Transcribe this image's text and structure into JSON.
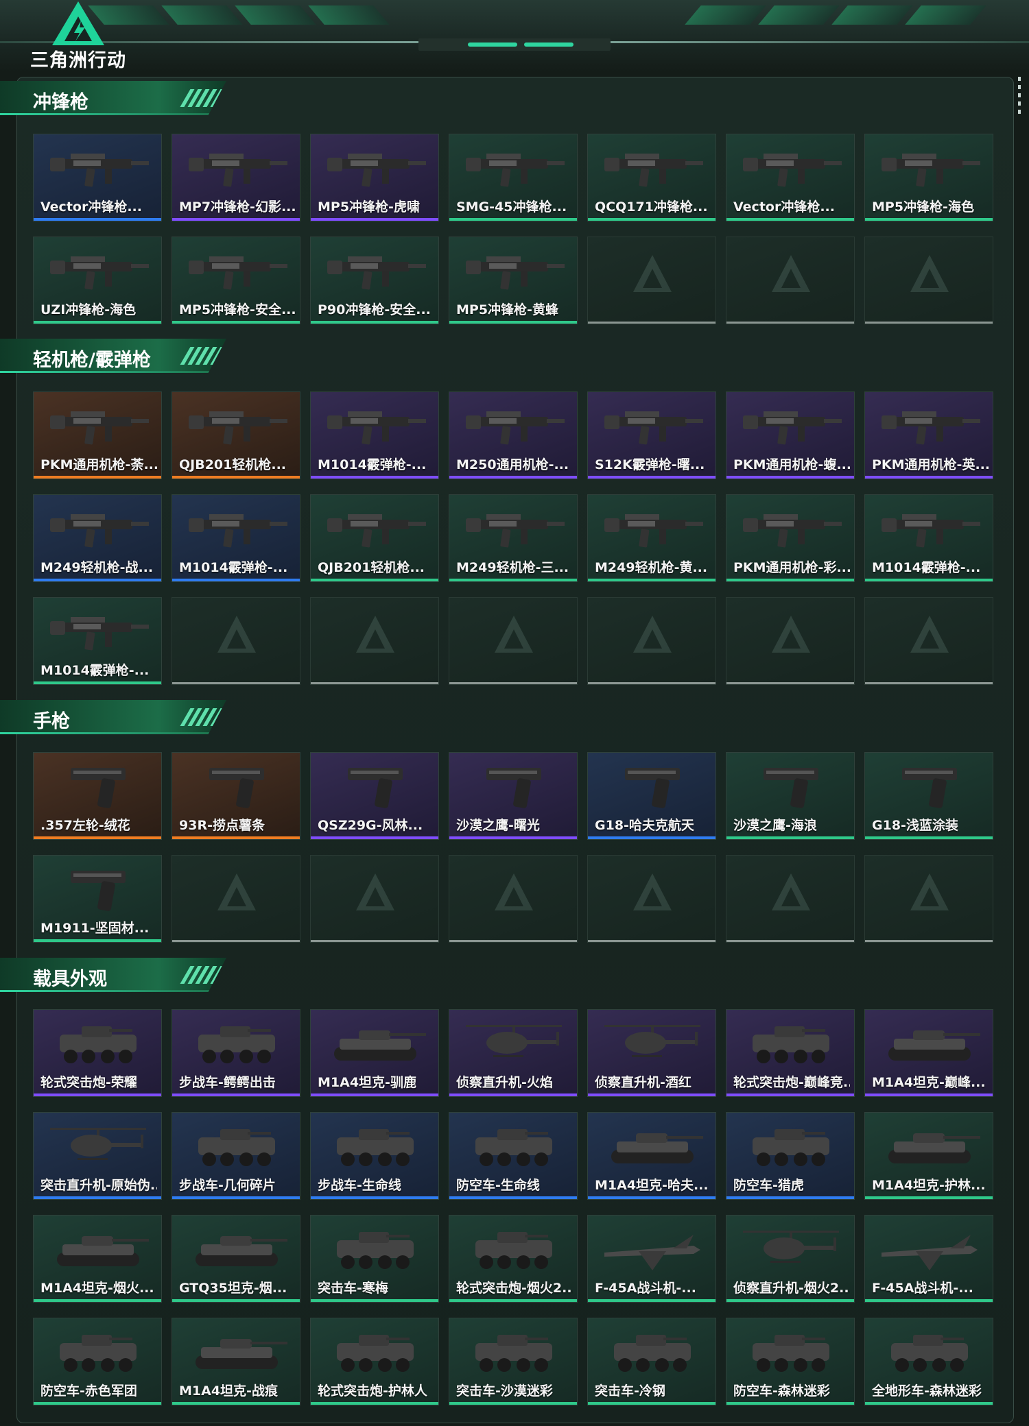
{
  "brand": {
    "logo_text": "三角洲行动"
  },
  "sections": [
    {
      "title": "冲锋枪",
      "items": [
        {
          "name": "Vector冲锋枪...",
          "rarity": "blue",
          "icon": "gun-icon"
        },
        {
          "name": "MP7冲锋枪-幻影...",
          "rarity": "purple",
          "icon": "gun-icon"
        },
        {
          "name": "MP5冲锋枪-虎啸",
          "rarity": "purple",
          "icon": "gun-icon"
        },
        {
          "name": "SMG-45冲锋枪...",
          "rarity": "green",
          "icon": "gun-icon"
        },
        {
          "name": "QCQ171冲锋枪...",
          "rarity": "green",
          "icon": "gun-icon"
        },
        {
          "name": "Vector冲锋枪...",
          "rarity": "green",
          "icon": "gun-icon"
        },
        {
          "name": "MP5冲锋枪-海色",
          "rarity": "green",
          "icon": "gun-icon"
        },
        {
          "name": "UZI冲锋枪-海色",
          "rarity": "green",
          "icon": "gun-icon"
        },
        {
          "name": "MP5冲锋枪-安全...",
          "rarity": "green",
          "icon": "gun-icon"
        },
        {
          "name": "P90冲锋枪-安全...",
          "rarity": "green",
          "icon": "gun-icon"
        },
        {
          "name": "MP5冲锋枪-黄蜂",
          "rarity": "green",
          "icon": "gun-icon"
        },
        {
          "name": "",
          "rarity": "empty"
        },
        {
          "name": "",
          "rarity": "empty"
        },
        {
          "name": "",
          "rarity": "empty"
        }
      ]
    },
    {
      "title": "轻机枪/霰弹枪",
      "items": [
        {
          "name": "PKM通用机枪-荼...",
          "rarity": "orange",
          "icon": "gun-icon"
        },
        {
          "name": "QJB201轻机枪...",
          "rarity": "orange",
          "icon": "gun-icon"
        },
        {
          "name": "M1014霰弹枪-...",
          "rarity": "purple",
          "icon": "gun-icon"
        },
        {
          "name": "M250通用机枪-...",
          "rarity": "purple",
          "icon": "gun-icon"
        },
        {
          "name": "S12K霰弹枪-曙...",
          "rarity": "purple",
          "icon": "gun-icon"
        },
        {
          "name": "PKM通用机枪-蝮...",
          "rarity": "purple",
          "icon": "gun-icon"
        },
        {
          "name": "PKM通用机枪-英...",
          "rarity": "purple",
          "icon": "gun-icon"
        },
        {
          "name": "M249轻机枪-战...",
          "rarity": "blue",
          "icon": "gun-icon"
        },
        {
          "name": "M1014霰弹枪-...",
          "rarity": "blue",
          "icon": "gun-icon"
        },
        {
          "name": "QJB201轻机枪...",
          "rarity": "green",
          "icon": "gun-icon"
        },
        {
          "name": "M249轻机枪-三...",
          "rarity": "green",
          "icon": "gun-icon"
        },
        {
          "name": "M249轻机枪-黄...",
          "rarity": "green",
          "icon": "gun-icon"
        },
        {
          "name": "PKM通用机枪-彩...",
          "rarity": "green",
          "icon": "gun-icon"
        },
        {
          "name": "M1014霰弹枪-...",
          "rarity": "green",
          "icon": "gun-icon"
        },
        {
          "name": "M1014霰弹枪-...",
          "rarity": "green",
          "icon": "gun-icon"
        },
        {
          "name": "",
          "rarity": "empty"
        },
        {
          "name": "",
          "rarity": "empty"
        },
        {
          "name": "",
          "rarity": "empty"
        },
        {
          "name": "",
          "rarity": "empty"
        },
        {
          "name": "",
          "rarity": "empty"
        },
        {
          "name": "",
          "rarity": "empty"
        }
      ]
    },
    {
      "title": "手枪",
      "items": [
        {
          "name": ".357左轮-绒花",
          "rarity": "orange",
          "icon": "pistol-icon"
        },
        {
          "name": "93R-捞点薯条",
          "rarity": "orange",
          "icon": "pistol-icon"
        },
        {
          "name": "QSZ29G-风林...",
          "rarity": "purple",
          "icon": "pistol-icon"
        },
        {
          "name": "沙漠之鹰-曙光",
          "rarity": "purple",
          "icon": "pistol-icon"
        },
        {
          "name": "G18-哈夫克航天",
          "rarity": "blue",
          "icon": "pistol-icon"
        },
        {
          "name": "沙漠之鹰-海浪",
          "rarity": "green",
          "icon": "pistol-icon"
        },
        {
          "name": "G18-浅蓝涂装",
          "rarity": "green",
          "icon": "pistol-icon"
        },
        {
          "name": "M1911-坚固材...",
          "rarity": "green",
          "icon": "pistol-icon"
        },
        {
          "name": "",
          "rarity": "empty"
        },
        {
          "name": "",
          "rarity": "empty"
        },
        {
          "name": "",
          "rarity": "empty"
        },
        {
          "name": "",
          "rarity": "empty"
        },
        {
          "name": "",
          "rarity": "empty"
        },
        {
          "name": "",
          "rarity": "empty"
        }
      ]
    },
    {
      "title": "载具外观",
      "items": [
        {
          "name": "轮式突击炮-荣耀",
          "rarity": "purple",
          "icon": "vehicle-icon"
        },
        {
          "name": "步战车-鳄鳄出击",
          "rarity": "purple",
          "icon": "vehicle-icon"
        },
        {
          "name": "M1A4坦克-驯鹿",
          "rarity": "purple",
          "icon": "tank-icon"
        },
        {
          "name": "侦察直升机-火焰",
          "rarity": "purple",
          "icon": "helicopter-icon"
        },
        {
          "name": "侦察直升机-酒红",
          "rarity": "purple",
          "icon": "helicopter-icon"
        },
        {
          "name": "轮式突击炮-巅峰竞...",
          "rarity": "purple",
          "icon": "vehicle-icon"
        },
        {
          "name": "M1A4坦克-巅峰...",
          "rarity": "purple",
          "icon": "tank-icon"
        },
        {
          "name": "突击直升机-原始伪...",
          "rarity": "blue",
          "icon": "helicopter-icon"
        },
        {
          "name": "步战车-几何碎片",
          "rarity": "blue",
          "icon": "vehicle-icon"
        },
        {
          "name": "步战车-生命线",
          "rarity": "blue",
          "icon": "vehicle-icon"
        },
        {
          "name": "防空车-生命线",
          "rarity": "blue",
          "icon": "vehicle-icon"
        },
        {
          "name": "M1A4坦克-哈夫...",
          "rarity": "blue",
          "icon": "tank-icon"
        },
        {
          "name": "防空车-猎虎",
          "rarity": "blue",
          "icon": "vehicle-icon"
        },
        {
          "name": "M1A4坦克-护林...",
          "rarity": "green",
          "icon": "tank-icon"
        },
        {
          "name": "M1A4坦克-烟火...",
          "rarity": "green",
          "icon": "tank-icon"
        },
        {
          "name": "GTQ35坦克-烟...",
          "rarity": "green",
          "icon": "tank-icon"
        },
        {
          "name": "突击车-寒梅",
          "rarity": "green",
          "icon": "vehicle-icon"
        },
        {
          "name": "轮式突击炮-烟火2...",
          "rarity": "green",
          "icon": "vehicle-icon"
        },
        {
          "name": "F-45A战斗机-...",
          "rarity": "green",
          "icon": "jet-icon"
        },
        {
          "name": "侦察直升机-烟火2...",
          "rarity": "green",
          "icon": "helicopter-icon"
        },
        {
          "name": "F-45A战斗机-...",
          "rarity": "green",
          "icon": "jet-icon"
        },
        {
          "name": "防空车-赤色军团",
          "rarity": "green",
          "icon": "vehicle-icon"
        },
        {
          "name": "M1A4坦克-战痕",
          "rarity": "green",
          "icon": "tank-icon"
        },
        {
          "name": "轮式突击炮-护林人",
          "rarity": "green",
          "icon": "vehicle-icon"
        },
        {
          "name": "突击车-沙漠迷彩",
          "rarity": "green",
          "icon": "vehicle-icon"
        },
        {
          "name": "突击车-冷钢",
          "rarity": "green",
          "icon": "vehicle-icon"
        },
        {
          "name": "防空车-森林迷彩",
          "rarity": "green",
          "icon": "vehicle-icon"
        },
        {
          "name": "全地形车-森林迷彩",
          "rarity": "green",
          "icon": "vehicle-icon"
        }
      ]
    }
  ],
  "colors": {
    "accent": "#2fd6a0",
    "rarity_purple": "#7f4dff",
    "rarity_orange": "#f07d22",
    "rarity_blue": "#2f7cf0",
    "rarity_green": "#2fc98a"
  }
}
